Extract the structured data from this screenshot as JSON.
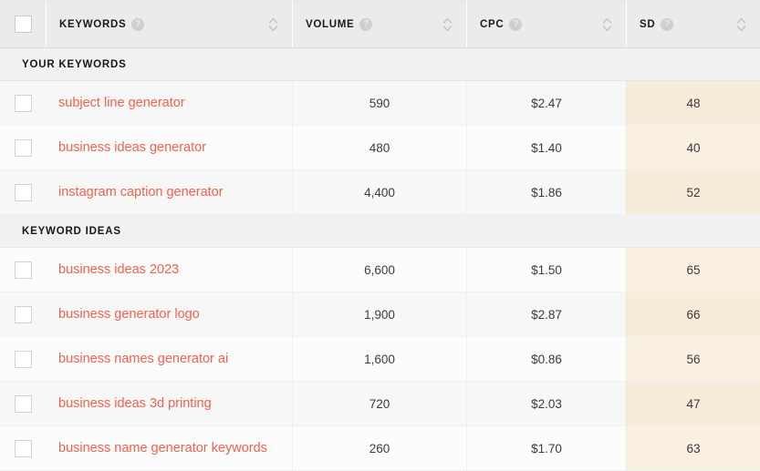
{
  "table": {
    "columns": [
      {
        "key": "select",
        "label": "",
        "has_help": false,
        "sortable": false,
        "icon": "checkbox-icon"
      },
      {
        "key": "keyword",
        "label": "KEYWORDS",
        "has_help": true,
        "sortable": true,
        "icon": "help-icon"
      },
      {
        "key": "volume",
        "label": "VOLUME",
        "has_help": true,
        "sortable": true,
        "icon": "help-icon"
      },
      {
        "key": "cpc",
        "label": "CPC",
        "has_help": true,
        "sortable": true,
        "icon": "help-icon"
      },
      {
        "key": "sd",
        "label": "SD",
        "has_help": true,
        "sortable": true,
        "icon": "help-icon"
      }
    ],
    "help_glyph": "?",
    "sections": [
      {
        "title": "YOUR KEYWORDS",
        "rows": [
          {
            "keyword": "subject line generator",
            "volume": "590",
            "cpc": "$2.47",
            "sd": "48"
          },
          {
            "keyword": "business ideas generator",
            "volume": "480",
            "cpc": "$1.40",
            "sd": "40"
          },
          {
            "keyword": "instagram caption generator",
            "volume": "4,400",
            "cpc": "$1.86",
            "sd": "52"
          }
        ]
      },
      {
        "title": "KEYWORD IDEAS",
        "rows": [
          {
            "keyword": "business ideas 2023",
            "volume": "6,600",
            "cpc": "$1.50",
            "sd": "65"
          },
          {
            "keyword": "business generator logo",
            "volume": "1,900",
            "cpc": "$2.87",
            "sd": "66"
          },
          {
            "keyword": "business names generator ai",
            "volume": "1,600",
            "cpc": "$0.86",
            "sd": "56"
          },
          {
            "keyword": "business ideas 3d printing",
            "volume": "720",
            "cpc": "$2.03",
            "sd": "47"
          },
          {
            "keyword": "business name generator keywords",
            "volume": "260",
            "cpc": "$1.70",
            "sd": "63"
          }
        ]
      }
    ]
  },
  "colors": {
    "keyword_link": "#f4614c",
    "sd_background": "#f7ebd9",
    "header_background": "#ebebeb",
    "section_background": "#f1f1f2"
  }
}
